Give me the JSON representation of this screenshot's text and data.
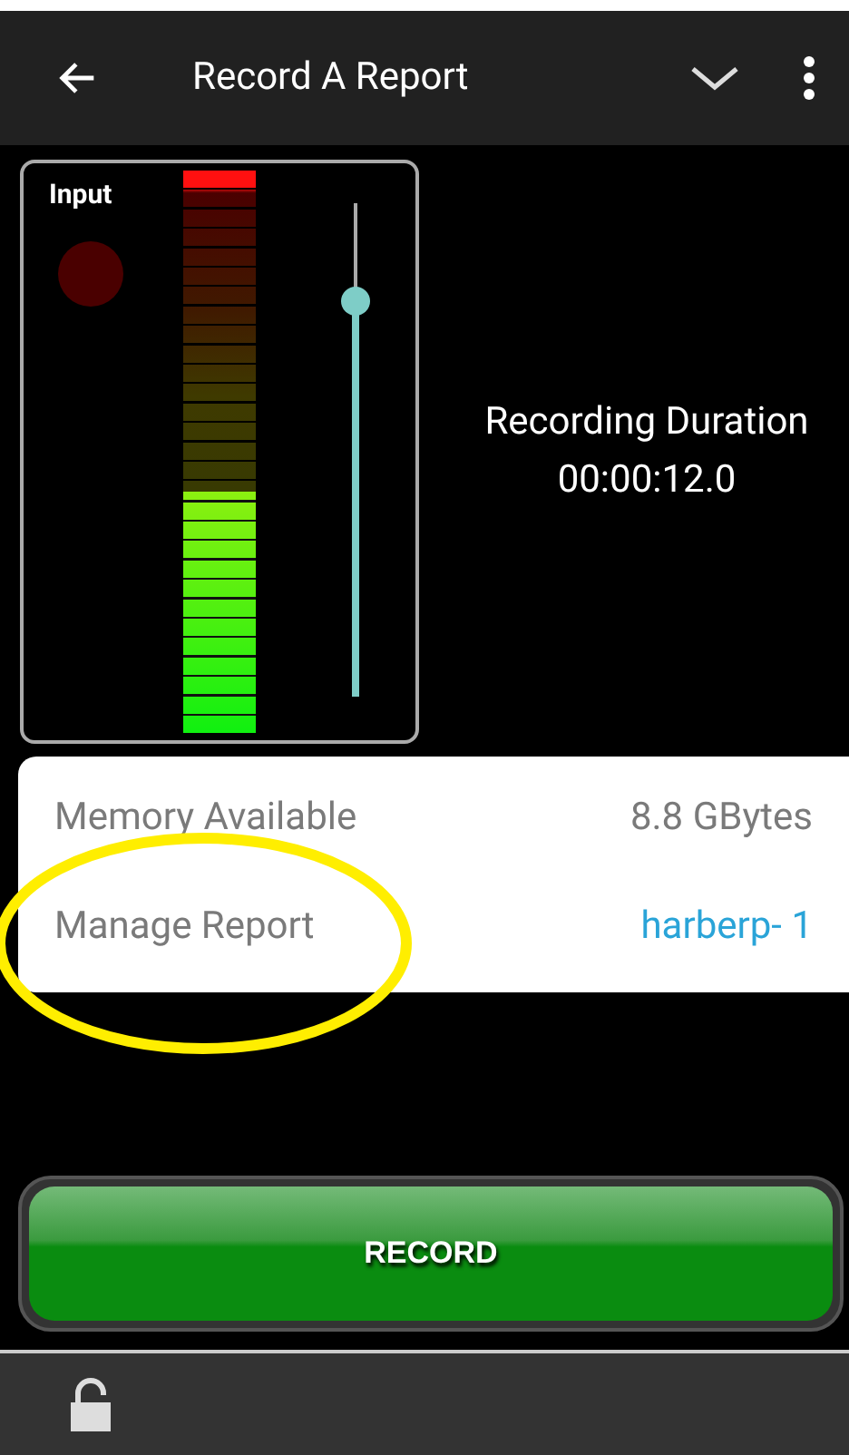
{
  "app_bar": {
    "title": "Record A Report"
  },
  "input_panel": {
    "label": "Input",
    "indicator": {
      "on": false
    },
    "meter": {
      "level": 0.43
    },
    "gain_slider": {
      "level": 0.8
    }
  },
  "duration": {
    "label": "Recording Duration",
    "value": "00:00:12.0"
  },
  "info_rows": [
    {
      "label": "Memory Available",
      "value": "8.8  GBytes",
      "kind": "plain"
    },
    {
      "label": "Manage Report",
      "value": "harberp- 1",
      "kind": "link"
    }
  ],
  "record_button": {
    "label": "RECORD"
  },
  "bottom_bar": {
    "locked": false
  }
}
